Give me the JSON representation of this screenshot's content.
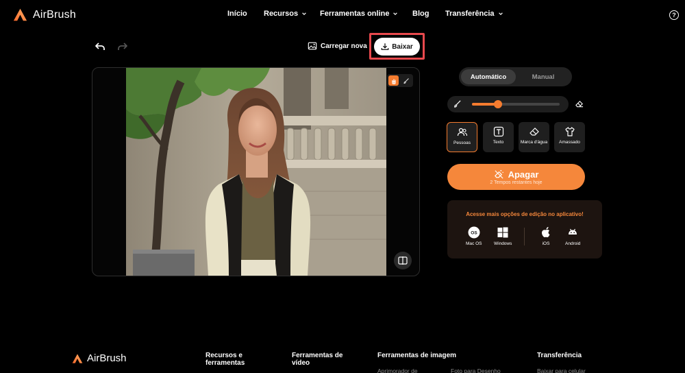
{
  "brand": {
    "name": "AirBrush",
    "accent": "#f57c2f",
    "highlight": "#e8494d"
  },
  "nav": {
    "items": [
      {
        "label": "Início",
        "dropdown": false
      },
      {
        "label": "Recursos",
        "dropdown": true
      },
      {
        "label": "Ferramentas online",
        "dropdown": true
      },
      {
        "label": "Blog",
        "dropdown": false
      },
      {
        "label": "Transferência",
        "dropdown": true
      }
    ],
    "help_icon": "question-circle-icon",
    "help_glyph": "?"
  },
  "toolbar": {
    "undo_icon": "undo-icon",
    "redo_icon": "redo-icon",
    "upload_label": "Carregar nova",
    "download_label": "Baixar"
  },
  "editor": {
    "image_alt": "Mulher sorrindo em rua da cidade",
    "tool_icons": [
      "hand-icon",
      "brush-icon"
    ],
    "compare_icon": "compare-icon"
  },
  "panel": {
    "modes": [
      "Automático",
      "Manual"
    ],
    "selected_mode": "Automático",
    "brush_size": 0.3,
    "tools": [
      {
        "label": "Pessoas",
        "icon": "people-icon",
        "active": true
      },
      {
        "label": "Texto",
        "icon": "text-icon",
        "active": false
      },
      {
        "label": "Marca d'água",
        "icon": "watermark-eraser-icon",
        "active": false
      },
      {
        "label": "Amassado",
        "icon": "shirt-icon",
        "active": false
      }
    ],
    "erase_label": "Apagar",
    "erase_sub": "2 Tempos restantes hoje",
    "app_promo": "Acesse mais opções de edição no aplicativo!",
    "apps": [
      {
        "label": "Mac OS",
        "icon": "macos-icon"
      },
      {
        "label": "Windows",
        "icon": "windows-icon"
      },
      {
        "label": "iOS",
        "icon": "apple-icon"
      },
      {
        "label": "Android",
        "icon": "android-icon"
      }
    ]
  },
  "footer": {
    "logo": "AirBrush",
    "columns": [
      {
        "title": "Recursos e ferramentas",
        "link": ""
      },
      {
        "title": "Ferramentas de vídeo",
        "link": ""
      },
      {
        "title": "Ferramentas de imagem",
        "link": "Aprimorador de"
      },
      {
        "title": "",
        "link": "Foto para Desenho"
      },
      {
        "title": "Transferência",
        "link": "Baixar para celular"
      }
    ]
  }
}
